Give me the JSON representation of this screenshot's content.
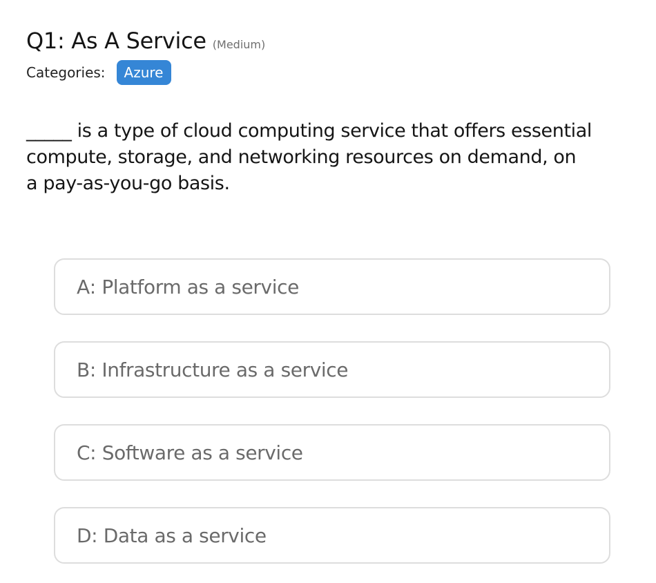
{
  "question": {
    "title": "Q1: As A Service",
    "difficulty": "(Medium)",
    "categories_label": "Categories:",
    "categories": [
      "Azure"
    ],
    "text": "_____ is a type of cloud computing service that offers essential compute, storage, and networking resources on demand, on a pay-as-you-go basis."
  },
  "options": [
    {
      "letter": "A",
      "label": "Platform as a service"
    },
    {
      "letter": "B",
      "label": "Infrastructure as a service"
    },
    {
      "letter": "C",
      "label": "Software as a service"
    },
    {
      "letter": "D",
      "label": "Data as a service"
    }
  ],
  "colors": {
    "tag_background": "#3586d6",
    "option_border": "#dddddd",
    "option_text": "#6a6a6a"
  }
}
